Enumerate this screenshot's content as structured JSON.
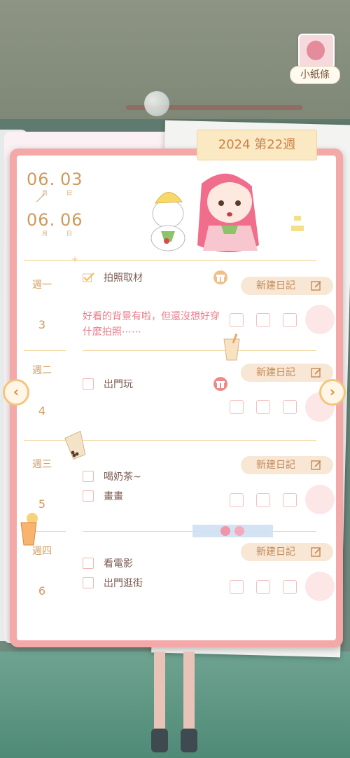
{
  "header": {
    "note_button_label": "小紙條",
    "week_tag": "2024 第22週"
  },
  "dates": {
    "start_month": "06.",
    "start_day": "03",
    "end_month": "06.",
    "end_day": "06",
    "month_unit": "月",
    "day_unit": "日"
  },
  "days": [
    {
      "weekday": "週一",
      "date": "3",
      "tasks": [
        {
          "text": "拍照取材",
          "done": true
        }
      ],
      "note": "好看的背景有啦，但還沒想好穿什麼拍照⋯⋯",
      "new_label": "新建日記"
    },
    {
      "weekday": "週二",
      "date": "4",
      "tasks": [
        {
          "text": "出門玩",
          "done": false
        }
      ],
      "new_label": "新建日記"
    },
    {
      "weekday": "週三",
      "date": "5",
      "tasks": [
        {
          "text": "喝奶茶~",
          "done": false
        },
        {
          "text": "畫畫",
          "done": false
        }
      ],
      "new_label": "新建日記"
    },
    {
      "weekday": "週四",
      "date": "6",
      "tasks": [
        {
          "text": "看電影",
          "done": false
        },
        {
          "text": "出門逛街",
          "done": false
        }
      ],
      "new_label": "新建日記"
    }
  ],
  "nav": {
    "prev_glyph": "‹",
    "next_glyph": "›"
  },
  "colors": {
    "card_border": "#f4a9a8",
    "accent_text": "#cf9a5c",
    "note_pink": "#ec7c8a",
    "button_bg": "#f7e7d4"
  }
}
